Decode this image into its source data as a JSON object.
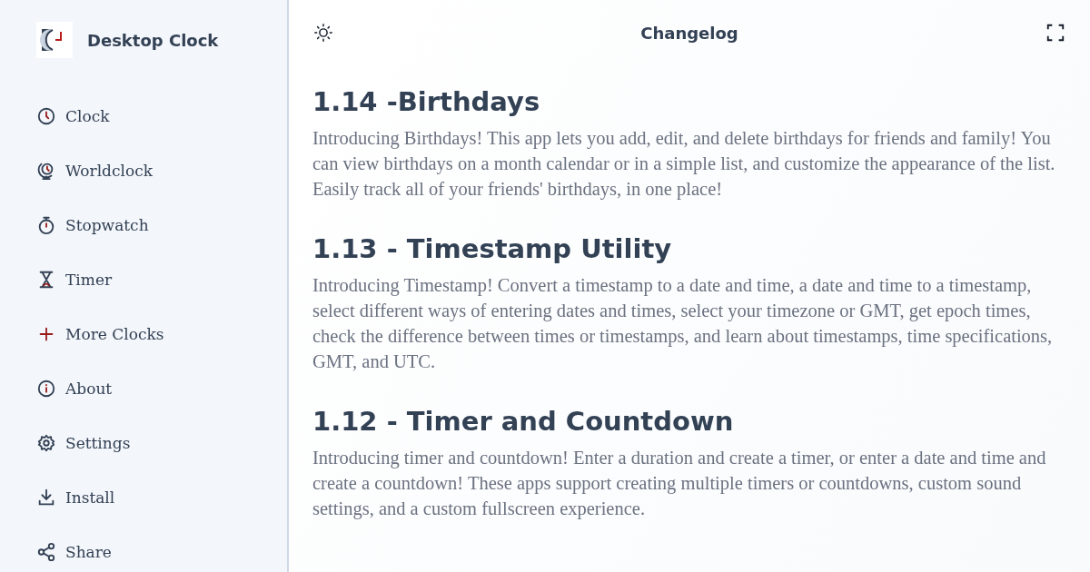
{
  "app": {
    "name": "Desktop Clock"
  },
  "sidebar": {
    "items": [
      {
        "kind": "clock",
        "label": "Clock"
      },
      {
        "kind": "globe",
        "label": "Worldclock"
      },
      {
        "kind": "stopwatch",
        "label": "Stopwatch"
      },
      {
        "kind": "hourglass",
        "label": "Timer"
      },
      {
        "kind": "plus",
        "label": "More Clocks"
      },
      {
        "kind": "info",
        "label": "About"
      },
      {
        "kind": "gear",
        "label": "Settings"
      },
      {
        "kind": "download",
        "label": "Install"
      },
      {
        "kind": "share",
        "label": "Share"
      }
    ]
  },
  "header": {
    "title": "Changelog"
  },
  "entries": [
    {
      "heading": "1.14 -Birthdays",
      "text": "Introducing Birthdays! This app lets you add, edit, and delete birthdays for friends and family! You can view birthdays on a month calendar or in a simple list, and customize the appearance of the list. Easily track all of your friends' birthdays, in one place!"
    },
    {
      "heading": "1.13 - Timestamp Utility",
      "text": "Introducing Timestamp! Convert a timestamp to a date and time, a date and time to a timestamp, select different ways of entering dates and times, select your timezone or GMT, get epoch times, check the difference between times or timestamps, and learn about timestamps, time specifications, GMT, and UTC."
    },
    {
      "heading": "1.12 - Timer and Countdown",
      "text": "Introducing timer and countdown! Enter a duration and create a timer, or enter a date and time and create a countdown! These apps support creating multiple timers or countdowns, custom sound settings, and a custom fullscreen experience."
    }
  ]
}
